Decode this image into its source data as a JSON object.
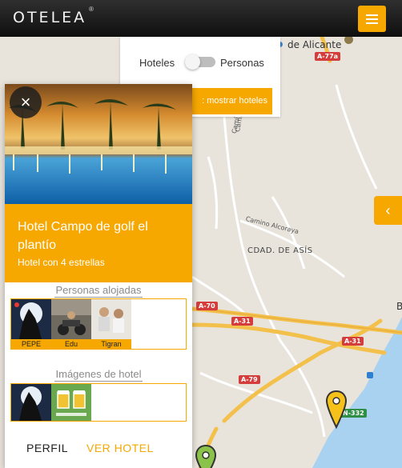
{
  "header": {
    "logo": "OTELEA",
    "logo_mark": "®",
    "menu_icon": "hamburger-icon"
  },
  "toggle": {
    "left_label": "Hoteles",
    "right_label": "Personas",
    "selected": "Hoteles",
    "button_label": ": mostrar hoteles"
  },
  "side_tab": {
    "icon": "chevron-left-icon",
    "glyph": "‹"
  },
  "map": {
    "city_label": "de Alicante",
    "district": "CDAD. DE ASÍS",
    "streets": [
      "Camí De L'alcoraia",
      "Camino Alcoraya",
      "Cami"
    ],
    "road_shields": [
      "A-77a",
      "A-70",
      "A-31",
      "A-31",
      "A-79",
      "N-332"
    ],
    "partial_letter": "B",
    "colors": {
      "land": "#e8e4dc",
      "sea": "#a9d2f0",
      "highway": "#f3c14b",
      "road": "#ffffff"
    }
  },
  "card": {
    "close_icon": "close-icon",
    "close_glyph": "×",
    "hotel_name": "Hotel Campo de golf el plantío",
    "stars_text": "Hotel con 4 estrellas",
    "guests_title": "Personas alojadas",
    "guests": [
      {
        "name": "PEPE"
      },
      {
        "name": "Edu"
      },
      {
        "name": "Tigran"
      }
    ],
    "images_title": "Imágenes de hotel",
    "tabs": {
      "perfil": "PERFIL",
      "ver_hotel": "VER HOTEL"
    },
    "accent": "#f6a800"
  }
}
